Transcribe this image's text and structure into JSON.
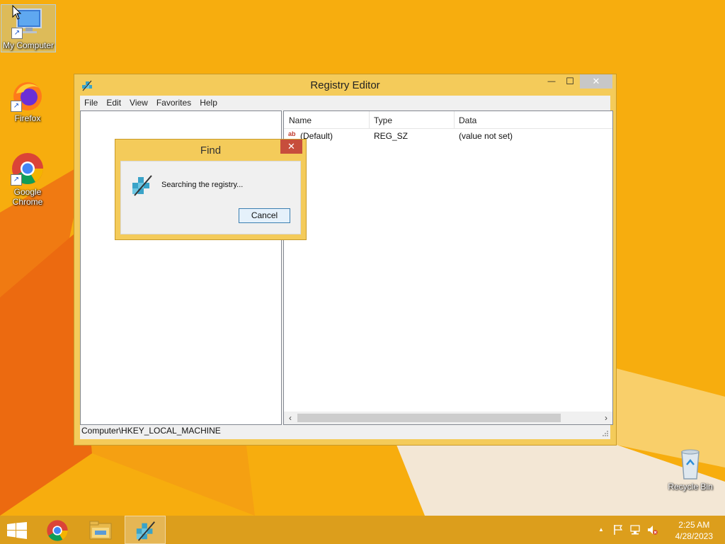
{
  "desktop": {
    "icons": [
      {
        "label": "My Computer",
        "name": "my-computer"
      },
      {
        "label": "Firefox",
        "name": "firefox"
      },
      {
        "label": "Google Chrome",
        "name": "google-chrome"
      },
      {
        "label": "Recycle Bin",
        "name": "recycle-bin"
      }
    ]
  },
  "window": {
    "title": "Registry Editor",
    "controls": {
      "minimize": "—",
      "maximize": "☐",
      "close": "✕"
    },
    "menu": [
      "File",
      "Edit",
      "View",
      "Favorites",
      "Help"
    ],
    "list": {
      "columns": [
        "Name",
        "Type",
        "Data"
      ],
      "rows": [
        {
          "icon": "ab",
          "name": "(Default)",
          "type": "REG_SZ",
          "data": "(value not set)"
        }
      ]
    },
    "scroll": {
      "left": "‹",
      "right": "›"
    },
    "status": "Computer\\HKEY_LOCAL_MACHINE"
  },
  "find_dialog": {
    "title": "Find",
    "close": "✕",
    "message": "Searching the registry...",
    "cancel_label": "Cancel"
  },
  "taskbar": {
    "items": [
      "start-button",
      "chrome",
      "file-explorer",
      "registry-editor"
    ],
    "time": "2:25 AM",
    "date": "4/28/2023",
    "tray": {
      "up_arrow": "▲"
    }
  },
  "colors": {
    "wallpaper": "#f7ad0e",
    "window_frame": "#f4cb5a",
    "close_red": "#c74e3c"
  }
}
